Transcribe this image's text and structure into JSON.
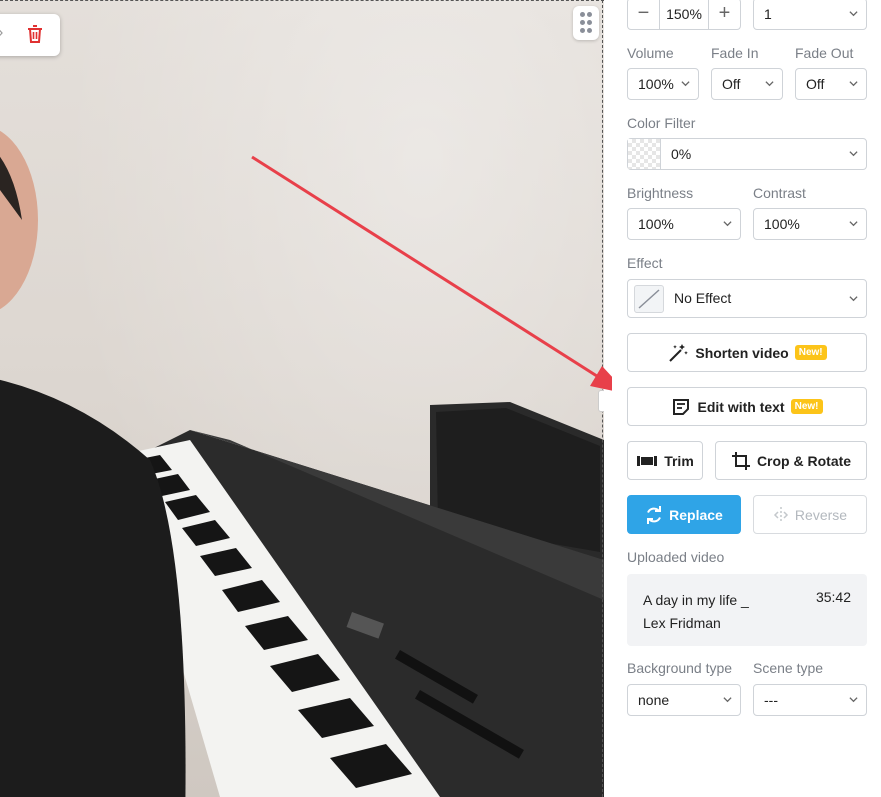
{
  "panel": {
    "zoom_value": "150%",
    "layer_value": "1",
    "volume": {
      "label": "Volume",
      "value": "100%"
    },
    "fade_in": {
      "label": "Fade In",
      "value": "Off"
    },
    "fade_out": {
      "label": "Fade Out",
      "value": "Off"
    },
    "color_filter": {
      "label": "Color Filter",
      "value": "0%"
    },
    "brightness": {
      "label": "Brightness",
      "value": "100%"
    },
    "contrast": {
      "label": "Contrast",
      "value": "100%"
    },
    "effect": {
      "label": "Effect",
      "value": "No Effect"
    },
    "shorten_video": {
      "label": "Shorten video",
      "badge": "New!"
    },
    "edit_with_text": {
      "label": "Edit with text",
      "badge": "New!"
    },
    "trim_label": "Trim",
    "crop_rotate_label": "Crop & Rotate",
    "replace_label": "Replace",
    "reverse_label": "Reverse",
    "uploaded": {
      "label": "Uploaded video",
      "title_line1": "A day in my life _",
      "title_line2": "Lex Fridman",
      "duration": "35:42"
    },
    "background_type": {
      "label": "Background type",
      "value": "none"
    },
    "scene_type": {
      "label": "Scene type",
      "value": "---"
    }
  },
  "colors": {
    "accent": "#2fa4e7",
    "badge": "#fcc419",
    "delete": "#e03131",
    "arrow": "#e8404a"
  }
}
